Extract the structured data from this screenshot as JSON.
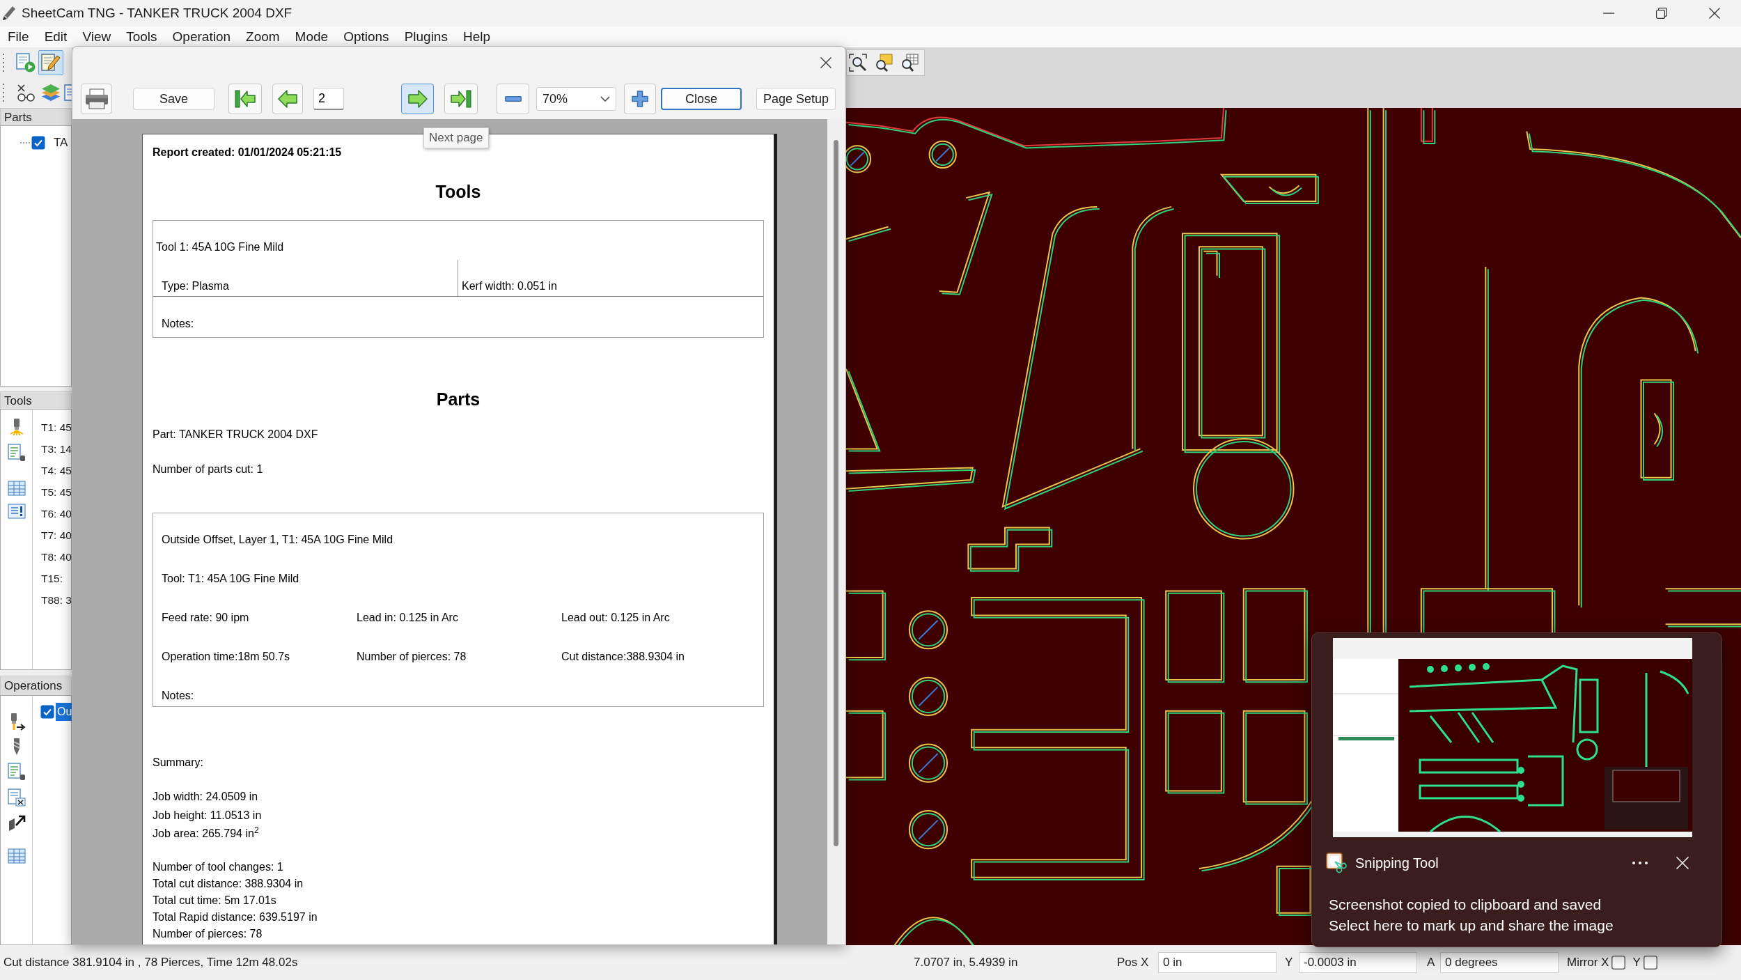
{
  "window": {
    "title": "SheetCam TNG - TANKER TRUCK 2004 DXF"
  },
  "menu": [
    "File",
    "Edit",
    "View",
    "Tools",
    "Operation",
    "Zoom",
    "Mode",
    "Options",
    "Plugins",
    "Help"
  ],
  "toolbar": {
    "rows": [
      [
        {
          "pressed": false
        },
        {
          "pressed": true
        }
      ],
      [
        {
          "pressed": false
        },
        {
          "pressed": false
        },
        {
          "pressed": false
        }
      ]
    ]
  },
  "parts_panel": {
    "title": "Parts",
    "items": [
      {
        "label": "TA",
        "checked": true
      }
    ]
  },
  "tools_panel": {
    "title": "Tools",
    "items": [
      "T1: 45",
      "T3: 14",
      "T4: 45",
      "T5: 45",
      "T6: 40",
      "T7: 40",
      "T8: 40",
      "T15:",
      "T88: 3"
    ]
  },
  "operations_panel": {
    "title": "Operations",
    "items": [
      {
        "label": "Ou",
        "checked": true,
        "selected": true
      }
    ]
  },
  "preview_dialog": {
    "toolbar": [
      {
        "kind": "print",
        "hovered": false
      },
      {
        "kind": "button",
        "label": "Save",
        "default": false,
        "hovered": false
      },
      {
        "kind": "first",
        "hovered": false
      },
      {
        "kind": "previous",
        "hovered": false
      },
      {
        "kind": "page",
        "value": "2"
      },
      {
        "kind": "next",
        "hovered": true
      },
      {
        "kind": "last",
        "hovered": false
      },
      {
        "kind": "zoomout",
        "hovered": false
      },
      {
        "kind": "zoom",
        "value": "70%"
      },
      {
        "kind": "zoomin",
        "hovered": false
      },
      {
        "kind": "button",
        "label": "Close",
        "default": true,
        "hovered": false
      },
      {
        "kind": "button",
        "label": "Page Setup",
        "default": false,
        "hovered": false
      }
    ],
    "tooltip": "Next page",
    "report": {
      "created": "Report created: 01/01/2024 05:21:15",
      "tools_heading": "Tools",
      "tool": {
        "name": "Tool 1: 45A 10G Fine Mild",
        "type": "Type: Plasma",
        "kerf": "Kerf width: 0.051 in",
        "notes": "Notes:"
      },
      "parts_heading": "Parts",
      "part": "Part: TANKER TRUCK 2004 DXF",
      "parts_cut": "Number of parts cut: 1",
      "operation": {
        "title": "Outside Offset, Layer 1, T1: 45A 10G Fine Mild",
        "tool": "Tool: T1: 45A 10G Fine Mild",
        "rows": [
          [
            "Feed rate: 90 ipm",
            "Lead in: 0.125 in Arc",
            "Lead out: 0.125 in Arc"
          ],
          [
            "Operation time:18m 50.7s",
            "Number of pierces: 78",
            "Cut distance:388.9304 in"
          ]
        ],
        "notes": "Notes:"
      },
      "summary_label": "Summary:",
      "summary": [
        [
          "Job width: 24.0509 in",
          "Job height: 11.0513 in",
          "Job area: 265.794 in$^{2}$"
        ],
        [
          "Number of tool changes: 1",
          "Total cut distance: 388.9304 in",
          "Total cut time: 5m 17.01s",
          "Total Rapid distance: 639.5197 in",
          "Number of pierces: 78"
        ]
      ]
    }
  },
  "status_bar": {
    "message": "Cut distance 381.9104 in , 78 Pierces, Time 12m 48.02s",
    "cursor": "7.0707 in, 5.4939 in",
    "fields": [
      {
        "label": "Pos X",
        "value": "0 in"
      },
      {
        "label": "Y",
        "value": "-0.0003 in"
      },
      {
        "label": "A",
        "value": "0 degrees"
      }
    ],
    "mirror": [
      {
        "label": "Mirror X",
        "checked": false
      },
      {
        "label": "Y",
        "checked": false
      }
    ]
  },
  "notification": {
    "app": "Snipping Tool",
    "title": "Screenshot copied to clipboard and saved",
    "body": "Select here to mark up and share the image"
  }
}
